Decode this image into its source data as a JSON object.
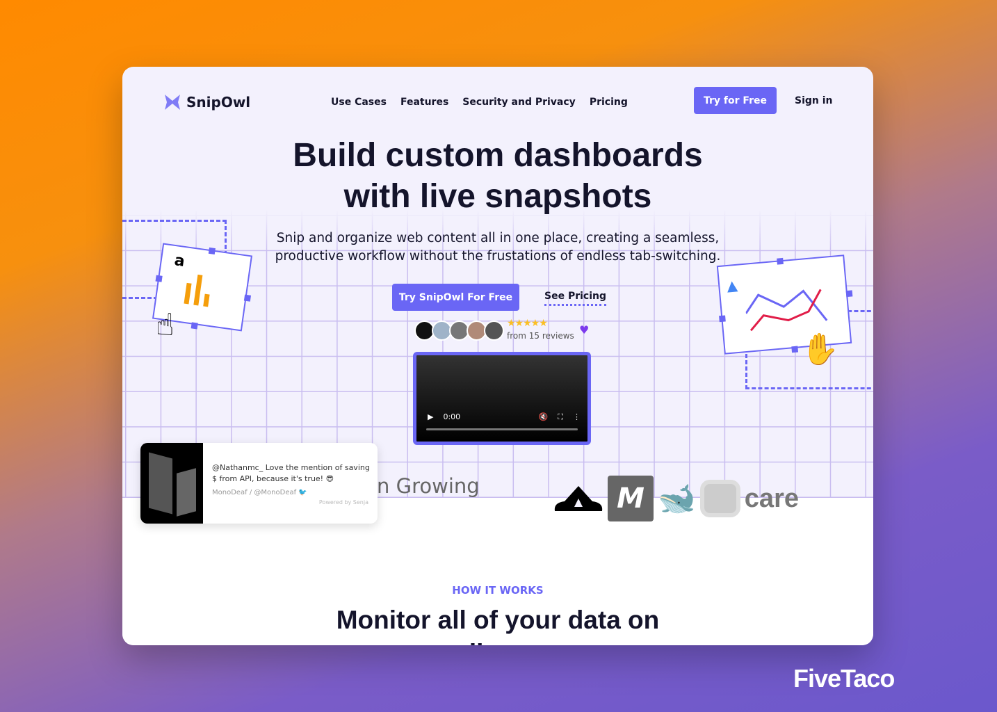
{
  "brand": {
    "name": "SnipOwl",
    "accent": "#6a66f5"
  },
  "nav": {
    "links": [
      "Use Cases",
      "Features",
      "Security and Privacy",
      "Pricing"
    ],
    "try_label": "Try for Free",
    "signin_label": "Sign in"
  },
  "hero": {
    "title_line1": "Build custom dashboards",
    "title_line2": "with live snapshots",
    "subtitle_line1": "Snip and organize web content all in one place, creating a seamless,",
    "subtitle_line2": "productive workflow without the frustations of endless tab-switching.",
    "cta_label": "Try SnipOwl For Free",
    "pricing_label": "See Pricing",
    "stars": "★★★★★",
    "reviews": "from 15 reviews",
    "rating": 5
  },
  "video": {
    "time": "0:00",
    "progress": 0
  },
  "testimonial": {
    "text": "@Nathanmc_ Love the mention of saving $ from API, because it's true! 😎",
    "author": "MonoDeaf / @MonoDeaf",
    "powered": "Powered by Senja"
  },
  "growing": "n Growing",
  "logos": [
    "care"
  ],
  "how": {
    "eyebrow": "HOW IT WORKS",
    "title_line1": "Monitor all of your data on",
    "title_line2": "one live page"
  },
  "watermark": "FiveTaco"
}
